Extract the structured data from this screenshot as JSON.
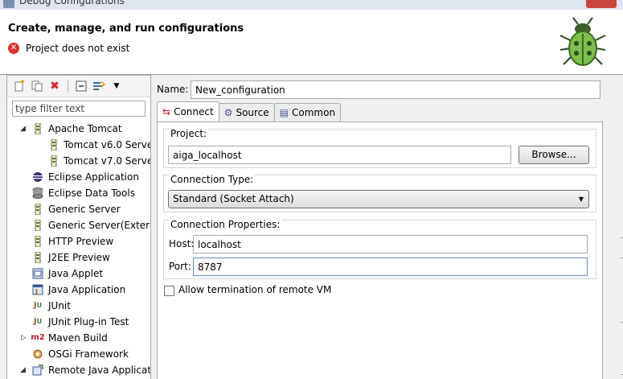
{
  "window": {
    "title": "Debug Configurations"
  },
  "header": {
    "title": "Create, manage, and run configurations",
    "error": "Project does not exist"
  },
  "toolbar": {
    "new_icon": "new-config-icon",
    "duplicate_icon": "duplicate-icon",
    "delete_icon": "delete-icon",
    "collapse_icon": "collapse-all-icon",
    "filter_icon": "filter-icon",
    "dropdown_icon": "chevron-down-icon"
  },
  "filter": {
    "placeholder": "type filter text",
    "value": ""
  },
  "tree": {
    "items": [
      {
        "label": "Apache Tomcat",
        "icon": "tomcat-icon",
        "expanded": true
      },
      {
        "label": "Tomcat v6.0 Serve",
        "icon": "server-icon",
        "indent": true
      },
      {
        "label": "Tomcat v7.0 Serve",
        "icon": "server-icon",
        "indent": true
      },
      {
        "label": "Eclipse Application",
        "icon": "eclipse-icon"
      },
      {
        "label": "Eclipse Data Tools",
        "icon": "database-icon"
      },
      {
        "label": "Generic Server",
        "icon": "server-icon"
      },
      {
        "label": "Generic Server(Extern",
        "icon": "server-icon"
      },
      {
        "label": "HTTP Preview",
        "icon": "server-icon"
      },
      {
        "label": "J2EE Preview",
        "icon": "server-icon"
      },
      {
        "label": "Java Applet",
        "icon": "applet-icon"
      },
      {
        "label": "Java Application",
        "icon": "java-app-icon"
      },
      {
        "label": "JUnit",
        "icon": "junit-icon"
      },
      {
        "label": "JUnit Plug-in Test",
        "icon": "junit-plugin-icon"
      },
      {
        "label": "Maven Build",
        "icon": "maven-icon",
        "collapsed": true
      },
      {
        "label": "OSGi Framework",
        "icon": "osgi-icon"
      },
      {
        "label": "Remote Java Applicat",
        "icon": "remote-java-icon",
        "expanded": true
      }
    ]
  },
  "config": {
    "name_label": "Name:",
    "name_value": "New_configuration",
    "tabs": [
      {
        "label": "Connect",
        "icon": "connect-icon",
        "active": true
      },
      {
        "label": "Source",
        "icon": "source-icon"
      },
      {
        "label": "Common",
        "icon": "common-icon"
      }
    ],
    "project": {
      "label": "Project:",
      "value": "aiga_localhost",
      "browse": "Browse..."
    },
    "connection_type": {
      "label": "Connection Type:",
      "value": "Standard (Socket Attach)"
    },
    "connection_properties": {
      "label": "Connection Properties:",
      "host_label": "Host:",
      "host_value": "localhost",
      "port_label": "Port:",
      "port_value": "8787"
    },
    "allow_termination": {
      "label": "Allow termination of remote VM",
      "checked": false
    }
  },
  "colors": {
    "error": "#d9322c",
    "accent": "#3c7fd1"
  }
}
